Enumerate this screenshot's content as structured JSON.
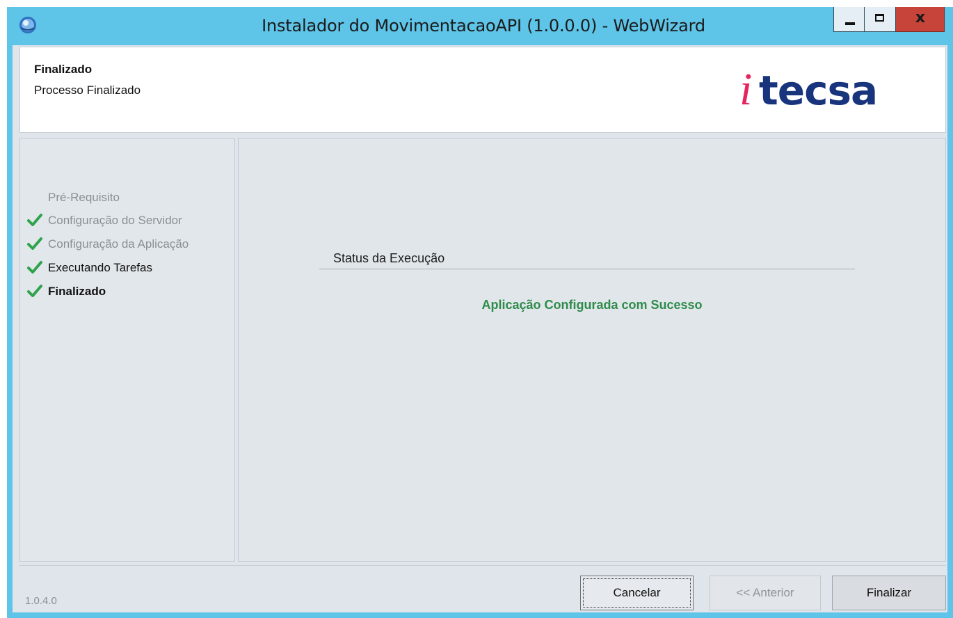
{
  "window": {
    "title": "Instalador do MovimentacaoAPI (1.0.0.0) - WebWizard",
    "close_label": "x"
  },
  "header": {
    "title": "Finalizado",
    "subtitle": "Processo Finalizado",
    "logo_text": "itecsa",
    "logo_colors": {
      "i": "#e8245f",
      "tecsa": "#17347d"
    }
  },
  "steps": [
    {
      "label": "Pré-Requisito",
      "state": "pending"
    },
    {
      "label": "Configuração do Servidor",
      "state": "done"
    },
    {
      "label": "Configuração da Aplicação",
      "state": "done"
    },
    {
      "label": "Executando Tarefas",
      "state": "normal"
    },
    {
      "label": "Finalizado",
      "state": "current"
    }
  ],
  "content": {
    "group_title": "Status da Execução",
    "status_message": "Aplicação Configurada com Sucesso",
    "status_color": "#2e8b4a"
  },
  "footer": {
    "version": "1.0.4.0",
    "cancel_label": "Cancelar",
    "previous_label": "<< Anterior",
    "finish_label": "Finalizar"
  },
  "icons": {
    "app": "installer-globe-icon",
    "check": "check-icon",
    "minimize": "minimize-icon",
    "maximize": "maximize-icon",
    "close": "close-icon"
  }
}
